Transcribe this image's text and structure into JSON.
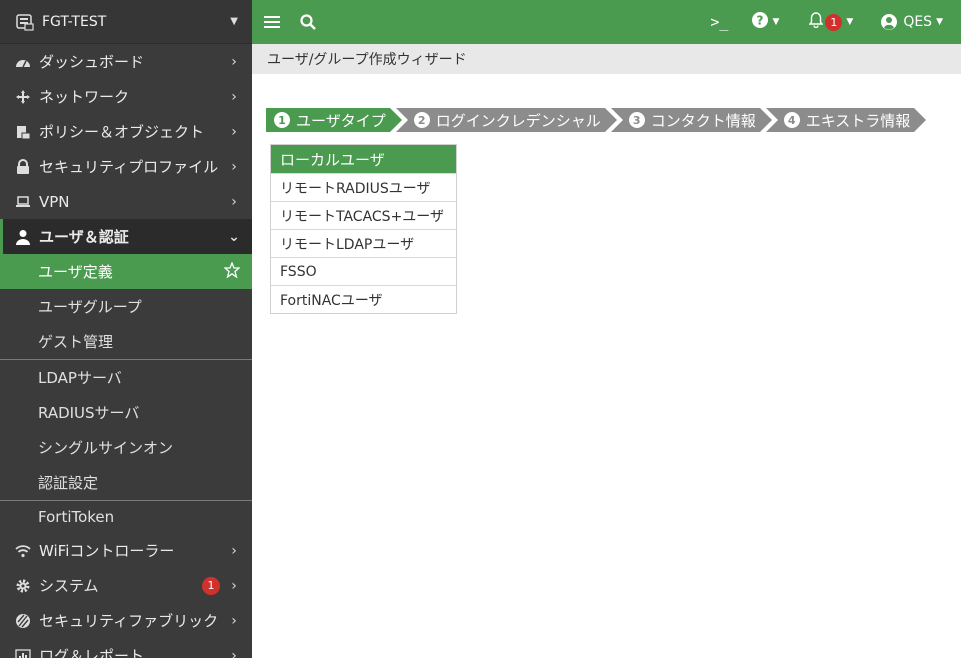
{
  "sidebar": {
    "device_name": "FGT-TEST",
    "items": [
      {
        "label": "ダッシュボード",
        "icon": "dashboard-icon"
      },
      {
        "label": "ネットワーク",
        "icon": "network-icon"
      },
      {
        "label": "ポリシー＆オブジェクト",
        "icon": "policy-icon"
      },
      {
        "label": "セキュリティプロファイル",
        "icon": "lock-icon"
      },
      {
        "label": "VPN",
        "icon": "laptop-icon"
      },
      {
        "label": "ユーザ＆認証",
        "icon": "user-icon"
      }
    ],
    "sub_items": {
      "user_def": "ユーザ定義",
      "user_group": "ユーザグループ",
      "guest": "ゲスト管理",
      "ldap": "LDAPサーバ",
      "radius": "RADIUSサーバ",
      "sso": "シングルサインオン",
      "auth_settings": "認証設定",
      "fortitoken": "FortiToken"
    },
    "lower_items": [
      {
        "label": "WiFiコントローラー",
        "icon": "wifi-icon"
      },
      {
        "label": "システム",
        "icon": "gear-icon",
        "badge": "1"
      },
      {
        "label": "セキュリティファブリック",
        "icon": "fabric-icon"
      },
      {
        "label": "ログ＆レポート",
        "icon": "chart-icon"
      }
    ]
  },
  "topbar": {
    "cli": ">_",
    "notification_count": "1",
    "user": "QES"
  },
  "page": {
    "title": "ユーザ/グループ作成ウィザード"
  },
  "wizard": {
    "steps": [
      {
        "num": "1",
        "label": "ユーザタイプ"
      },
      {
        "num": "2",
        "label": "ログインクレデンシャル"
      },
      {
        "num": "3",
        "label": "コンタクト情報"
      },
      {
        "num": "4",
        "label": "エキストラ情報"
      }
    ],
    "user_types": [
      "ローカルユーザ",
      "リモートRADIUSユーザ",
      "リモートTACACS+ユーザ",
      "リモートLDAPユーザ",
      "FSSO",
      "FortiNACユーザ"
    ]
  },
  "colors": {
    "accent": "#4a9a4f",
    "sidebar_bg": "#3b3b3b",
    "badge": "#d0312d",
    "inactive_step": "#8c8c8c"
  }
}
